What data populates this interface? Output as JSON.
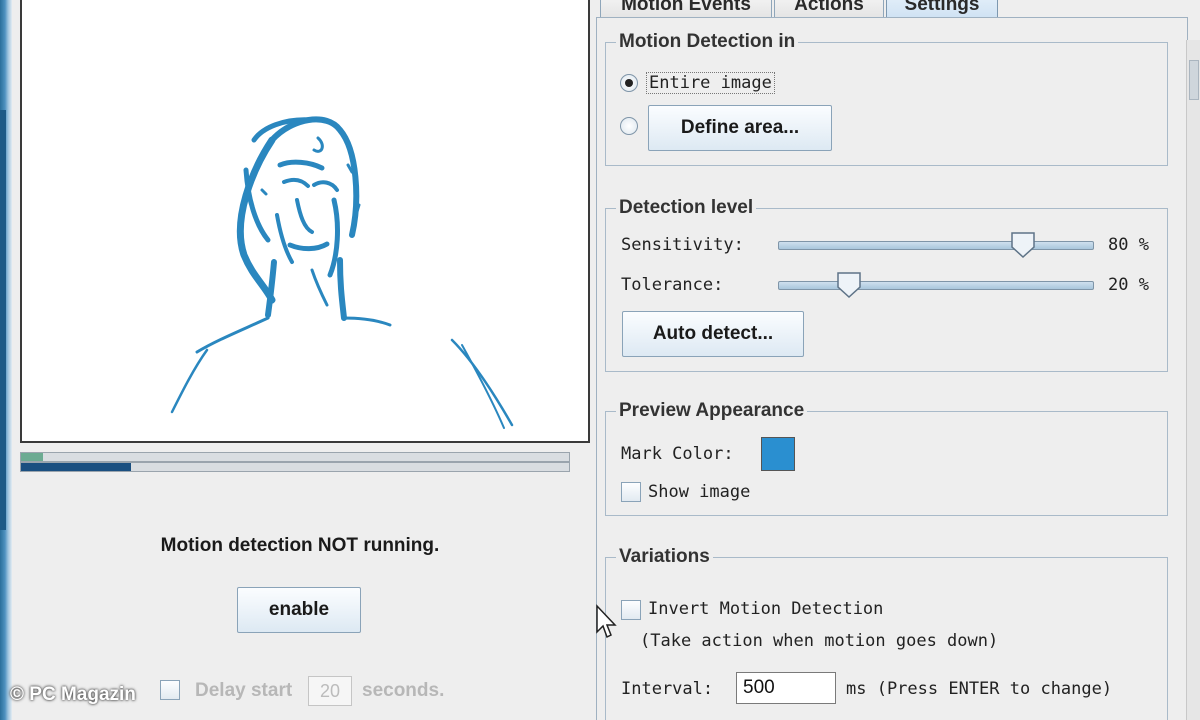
{
  "colors": {
    "mark_color": "#2a8fd0",
    "edge_color": "#2a87bf",
    "progress_top": "#6cab92",
    "progress_bottom": "#1a4f80"
  },
  "left": {
    "status": "Motion detection NOT running.",
    "enable_button": "enable",
    "delay_label": "Delay start",
    "delay_value": "20",
    "delay_unit": "seconds.",
    "progress_top_fraction": 0.04,
    "progress_bottom_fraction": 0.2
  },
  "watermark": "© PC Magazin",
  "tabs": [
    {
      "label": "Motion Events",
      "active": false
    },
    {
      "label": "Actions",
      "active": false
    },
    {
      "label": "Settings",
      "active": true
    }
  ],
  "motion_detection_in": {
    "title": "Motion Detection in",
    "option_entire": "Entire image",
    "option_define_button": "Define area...",
    "selected": "entire"
  },
  "detection_level": {
    "title": "Detection level",
    "sensitivity_label": "Sensitivity:",
    "sensitivity_value": 80,
    "sensitivity_display": "80 %",
    "tolerance_label": "Tolerance:",
    "tolerance_value": 20,
    "tolerance_display": "20 %",
    "auto_detect_button": "Auto detect..."
  },
  "preview_appearance": {
    "title": "Preview Appearance",
    "mark_color_label": "Mark Color:",
    "show_image_label": "Show image",
    "show_image_checked": false
  },
  "variations": {
    "title": "Variations",
    "invert_label": "Invert Motion Detection",
    "invert_hint": "(Take action when motion goes down)",
    "invert_checked": false,
    "interval_label": "Interval:",
    "interval_value": "500",
    "interval_unit": "ms (Press ENTER to change)"
  },
  "icons": [
    "radio-button-icon",
    "checkbox-icon",
    "slider-thumb-icon",
    "mouse-cursor-icon",
    "scroll-thumb-icon"
  ]
}
